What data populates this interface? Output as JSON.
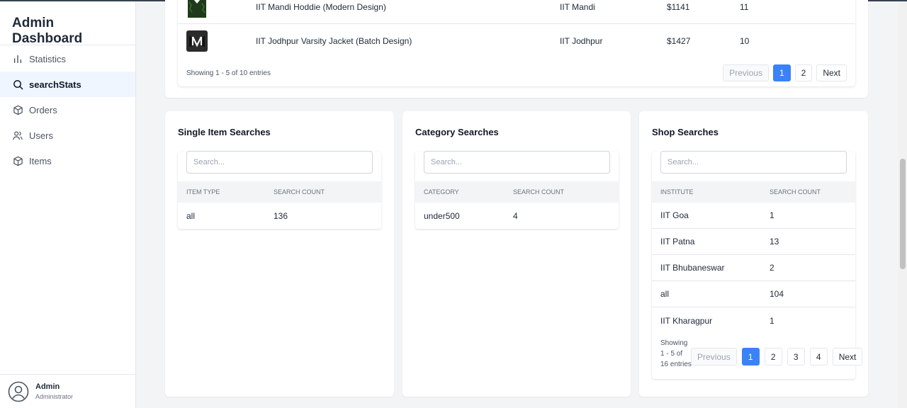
{
  "sidebar": {
    "title": "Admin Dashboard",
    "items": [
      {
        "label": "Statistics",
        "icon": "bar-chart-icon"
      },
      {
        "label": "searchStats",
        "icon": "search-icon"
      },
      {
        "label": "Orders",
        "icon": "box-icon"
      },
      {
        "label": "Users",
        "icon": "users-icon"
      },
      {
        "label": "Items",
        "icon": "box-icon"
      }
    ],
    "user": {
      "name": "Admin",
      "role": "Administrator"
    }
  },
  "items_table": {
    "rows": [
      {
        "name": "IIT Mandi Hoddie (Modern Design)",
        "institute": "IIT Mandi",
        "price": "$1141",
        "count": "11"
      },
      {
        "name": "IIT Jodhpur Varsity Jacket (Batch Design)",
        "institute": "IIT Jodhpur",
        "price": "$1427",
        "count": "10"
      }
    ],
    "showing": "Showing 1 - 5 of 10 entries",
    "pager": {
      "prev": "Previous",
      "pages": [
        "1",
        "2"
      ],
      "next": "Next"
    }
  },
  "single_item": {
    "title": "Single Item Searches",
    "placeholder": "Search...",
    "headers": [
      "ITEM TYPE",
      "SEARCH COUNT"
    ],
    "rows": [
      {
        "key": "all",
        "count": "136"
      }
    ]
  },
  "category": {
    "title": "Category Searches",
    "placeholder": "Search...",
    "headers": [
      "CATEGORY",
      "SEARCH COUNT"
    ],
    "rows": [
      {
        "key": "under500",
        "count": "4"
      }
    ]
  },
  "shop": {
    "title": "Shop Searches",
    "placeholder": "Search...",
    "headers": [
      "INSTITUTE",
      "SEARCH COUNT"
    ],
    "rows": [
      {
        "key": "IIT Goa",
        "count": "1"
      },
      {
        "key": "IIT Patna",
        "count": "13"
      },
      {
        "key": "IIT Bhubaneswar",
        "count": "2"
      },
      {
        "key": "all",
        "count": "104"
      },
      {
        "key": "IIT Kharagpur",
        "count": "1"
      }
    ],
    "showing": "Showing 1 - 5 of 16 entries",
    "pager": {
      "prev": "Previous",
      "pages": [
        "1",
        "2",
        "3",
        "4"
      ],
      "next": "Next"
    }
  },
  "colors": {
    "accent": "#3b82f6",
    "active_bg": "#eff6ff"
  }
}
